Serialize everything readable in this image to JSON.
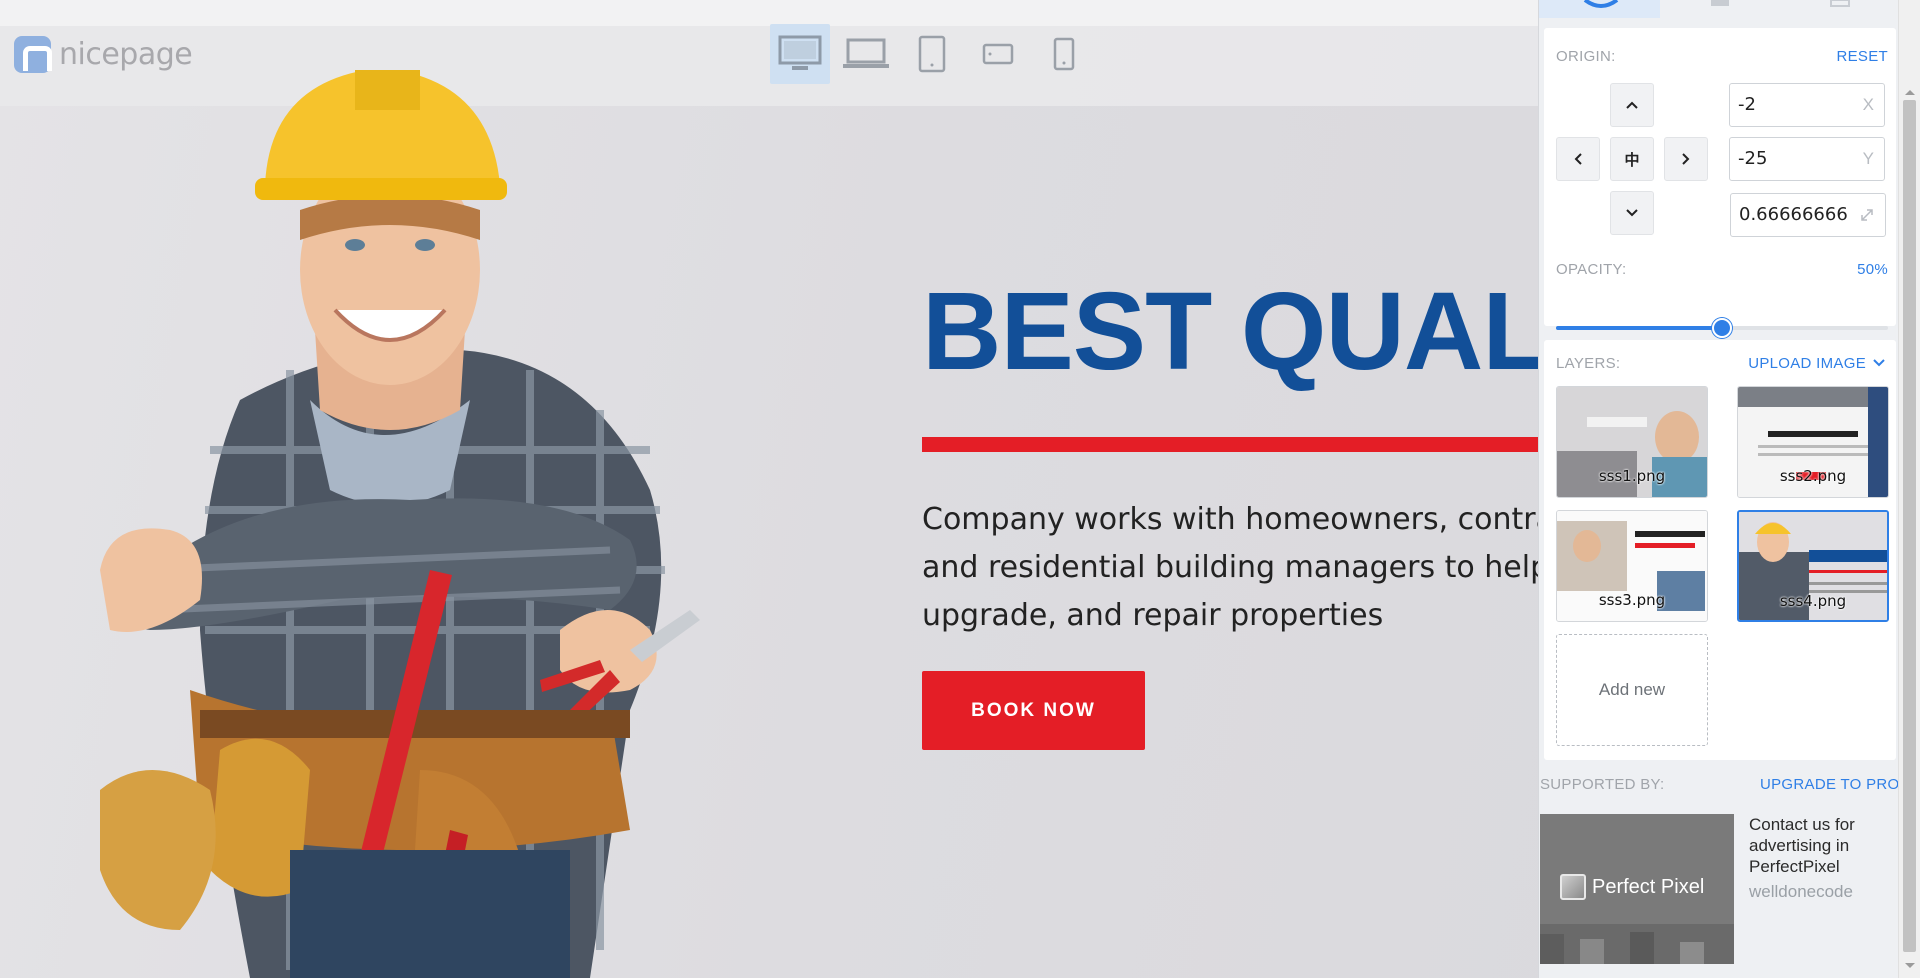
{
  "site": {
    "logo_text": "nicepage",
    "devices": [
      {
        "name": "desktop-icon",
        "active": true
      },
      {
        "name": "laptop-icon",
        "active": false
      },
      {
        "name": "tablet-icon",
        "active": false
      },
      {
        "name": "tablet-landscape-icon",
        "active": false
      },
      {
        "name": "phone-icon",
        "active": false
      }
    ],
    "hero": {
      "title": "BEST QUALIT",
      "text": "Company works with homeowners, contract\nand residential building managers to help m\nupgrade, and repair properties",
      "button": "BOOK NOW"
    },
    "colors": {
      "title": "#124f98",
      "accent": "#e41e26"
    }
  },
  "panel": {
    "origin_label": "ORIGIN:",
    "reset_label": "RESET",
    "center_glyph": "中",
    "x_value": "-2",
    "x_suffix": "X",
    "y_value": "-25",
    "y_suffix": "Y",
    "scale_value": "0.66666666",
    "opacity_label": "OPACITY:",
    "opacity_value": "50%",
    "opacity_fraction": 0.5,
    "layers_label": "LAYERS:",
    "upload_label": "UPLOAD IMAGE",
    "layers": [
      {
        "file": "sss1.png",
        "selected": false
      },
      {
        "file": "sss2.png",
        "selected": false
      },
      {
        "file": "sss3.png",
        "selected": false
      },
      {
        "file": "sss4.png",
        "selected": true
      }
    ],
    "add_new": "Add new",
    "supported_label": "SUPPORTED BY:",
    "upgrade_label": "UPGRADE TO PRO",
    "ad": {
      "brand": "Perfect Pixel",
      "text": "Contact us for advertising in PerfectPixel",
      "sub": "welldonecode"
    },
    "accent": "#2f7fe6"
  }
}
